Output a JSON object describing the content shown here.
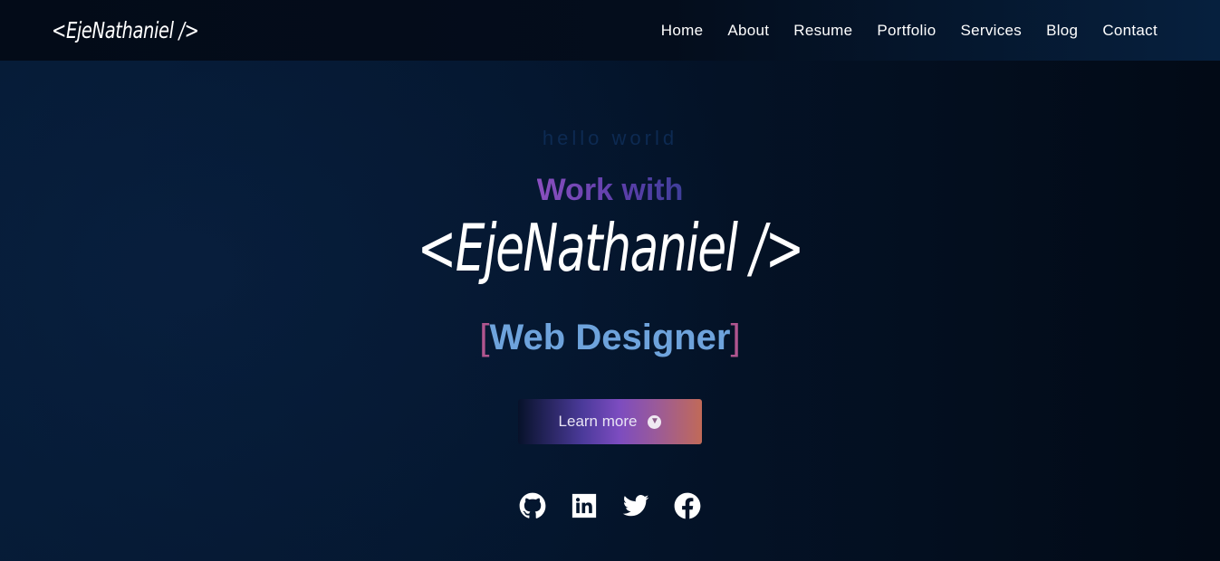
{
  "brand": {
    "logo_text": "<EjeNathaniel />"
  },
  "nav": {
    "items": [
      {
        "label": "Home"
      },
      {
        "label": "About"
      },
      {
        "label": "Resume"
      },
      {
        "label": "Portfolio"
      },
      {
        "label": "Services"
      },
      {
        "label": "Blog"
      },
      {
        "label": "Contact"
      }
    ]
  },
  "hero": {
    "greeting": "hello world",
    "intro": "Work with",
    "name": "<EjeNathaniel />",
    "role_open": "[",
    "role": "Web Designer",
    "role_close": "]",
    "cta_label": "Learn more",
    "cta_icon": "arrow-down-circle-icon"
  },
  "socials": [
    {
      "icon": "github-icon"
    },
    {
      "icon": "linkedin-icon"
    },
    {
      "icon": "twitter-icon"
    },
    {
      "icon": "facebook-icon"
    }
  ],
  "colors": {
    "background": "#041226",
    "accent_purple": "#7c4cc0",
    "accent_blue": "#6ea3dc",
    "accent_pink": "#b0558f"
  }
}
